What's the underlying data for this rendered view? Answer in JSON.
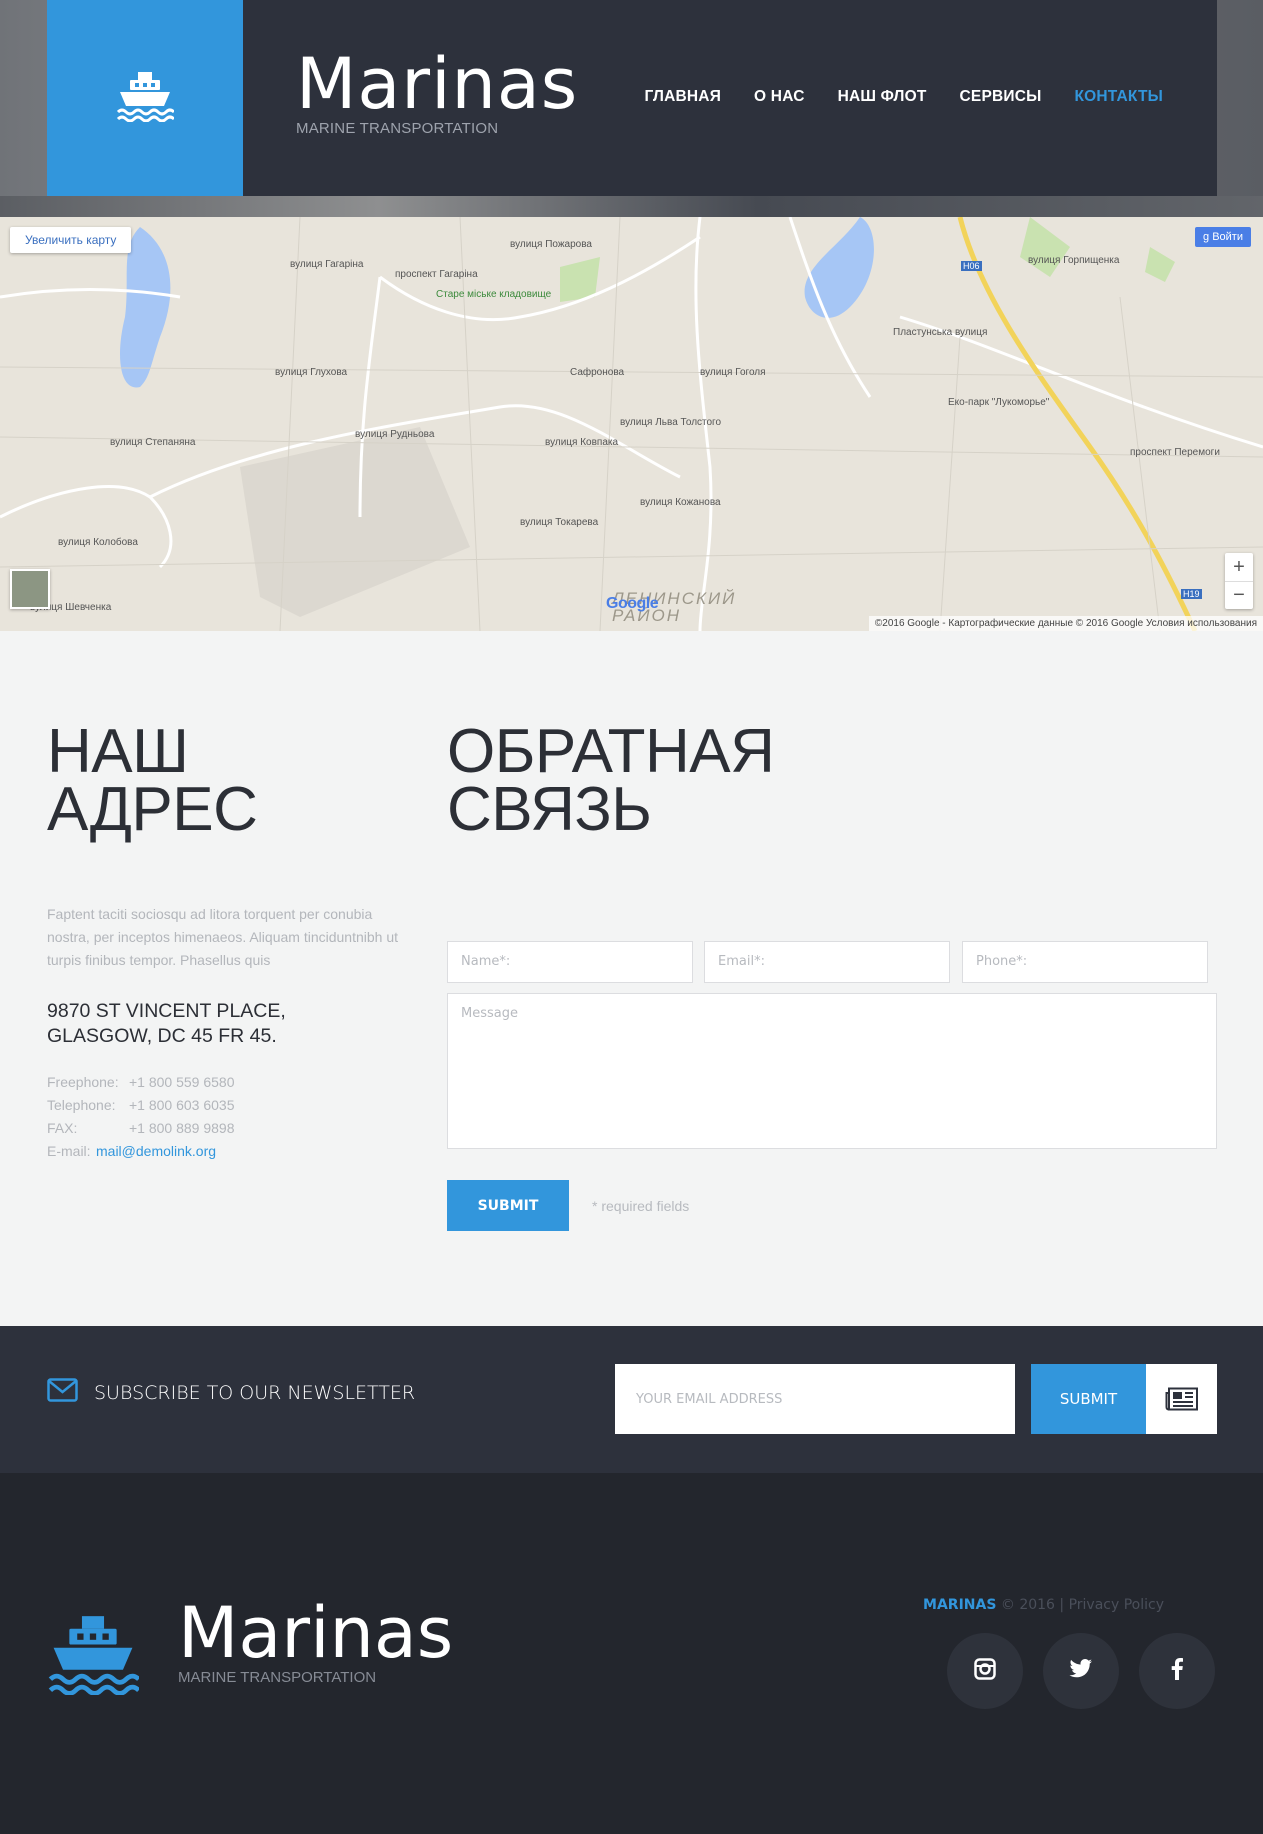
{
  "header": {
    "brand_title": "Marinas",
    "brand_subtitle": "MARINE TRANSPORTATION",
    "nav": [
      "ГЛАВНАЯ",
      "О НАС",
      "НАШ ФЛОТ",
      "СЕРВИСЫ",
      "КОНТАКТЫ"
    ],
    "active_nav": "КОНТАКТЫ"
  },
  "map": {
    "enlarge_label": "Увеличить карту",
    "login_label": "Войти",
    "zoom_in": "+",
    "zoom_out": "−",
    "google_logo": "Google",
    "district": "ЛЕНИНСКИЙ\nРАЙОН",
    "attribution": "©2016 Google - Картографические данные © 2016 Google   Условия использования",
    "labels": [
      "вулиця Гагаріна",
      "проспект Гагаріна",
      "Старе міське кладовище",
      "вулиця Пожарова",
      "вулиця Рудньова",
      "вулиця Глухова",
      "вулиця Кожанова",
      "вулиця Гоголя",
      "вулиця Горпищенка",
      "Пластунська вулиця",
      "Еко-парк \"Лукоморье\"",
      "проспект Перемоги",
      "вулиця Степаняна",
      "вулиця Токарева",
      "вулиця Ковпака",
      "вулиця Шевченка",
      "вулиця Колобова",
      "Сафронова",
      "вулиця Льва Толстого",
      "H06",
      "H19"
    ]
  },
  "contact": {
    "address_heading": "НАШ\nАДРЕС",
    "feedback_heading": "ОБРАТНАЯ\nСВЯЗЬ",
    "lorem": "Faptent taciti sociosqu ad litora torquent per conubia nostra, per inceptos himenaeos. Aliquam tinciduntnibh ut turpis finibus tempor. Phasellus quis",
    "address_line1": "9870 ST VINCENT PLACE,",
    "address_line2": "GLASGOW, DC 45 FR 45.",
    "details": [
      {
        "label": "Freephone:",
        "value": "+1 800 559 6580"
      },
      {
        "label": "Telephone:",
        "value": "+1 800 603 6035"
      },
      {
        "label": "FAX:",
        "value": "+1 800 889 9898"
      },
      {
        "label": "E-mail:",
        "value": "mail@demolink.org"
      }
    ],
    "form": {
      "name_placeholder": "Name*:",
      "email_placeholder": "Email*:",
      "phone_placeholder": "Phone*:",
      "message_placeholder": "Message",
      "submit_label": "SUBMIT",
      "required_note": "* required fields"
    }
  },
  "newsletter": {
    "label": "SUBSCRIBE TO OUR NEWSLETTER",
    "email_placeholder": "YOUR EMAIL ADDRESS",
    "submit_label": "SUBMIT"
  },
  "footer": {
    "brand_title": "Marinas",
    "brand_subtitle": "MARINE TRANSPORTATION",
    "copyright_brand": "MARINAS",
    "copyright_text": "© 2016 |",
    "privacy_link": "Privacy Policy",
    "socials": [
      "instagram-icon",
      "twitter-icon",
      "facebook-icon"
    ]
  },
  "colors": {
    "accent": "#3296dc",
    "header_bg": "#2d313c",
    "footer_bg": "#23262d",
    "page_bg": "#f3f4f4"
  }
}
